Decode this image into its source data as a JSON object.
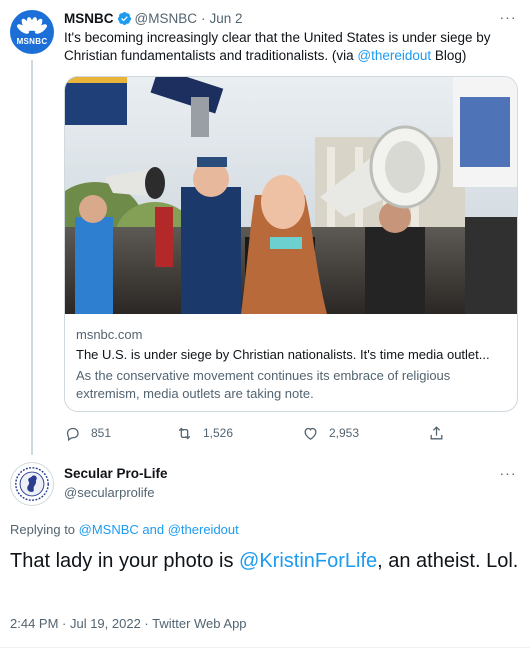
{
  "parent_tweet": {
    "avatar_text": "MSNBC",
    "name": "MSNBC",
    "handle": "@MSNBC",
    "separator": "·",
    "date": "Jun 2",
    "more_label": "···",
    "text_before": "It's becoming increasingly clear that the United States is under siege by Christian fundamentalists and traditionalists. (via ",
    "text_link": "@thereidout",
    "text_after": " Blog)",
    "card": {
      "image_desc_icon": "protest-photo-image",
      "domain": "msnbc.com",
      "title": "The U.S. is under siege by Christian nationalists. It's time media outlet...",
      "description": "As the conservative movement continues its embrace of religious extremism, media outlets are taking note."
    },
    "actions": {
      "replies": "851",
      "retweets": "1,526",
      "likes": "2,953"
    }
  },
  "main_tweet": {
    "name": "Secular Pro-Life",
    "handle": "@secularprolife",
    "more_label": "···",
    "replying_prefix": "Replying to ",
    "replying_user1": "@MSNBC",
    "replying_and": " and ",
    "replying_user2": "@thereidout",
    "text_before": "That lady in your photo is ",
    "text_link": "@KristinForLife",
    "text_after": ", an atheist. Lol.",
    "meta": "2:44 PM · Jul 19, 2022 · Twitter Web App"
  },
  "colors": {
    "link": "#1d9bf0",
    "muted": "#536471",
    "msnbc_blue": "#1d6fd8",
    "verified": "#1d9bf0"
  }
}
